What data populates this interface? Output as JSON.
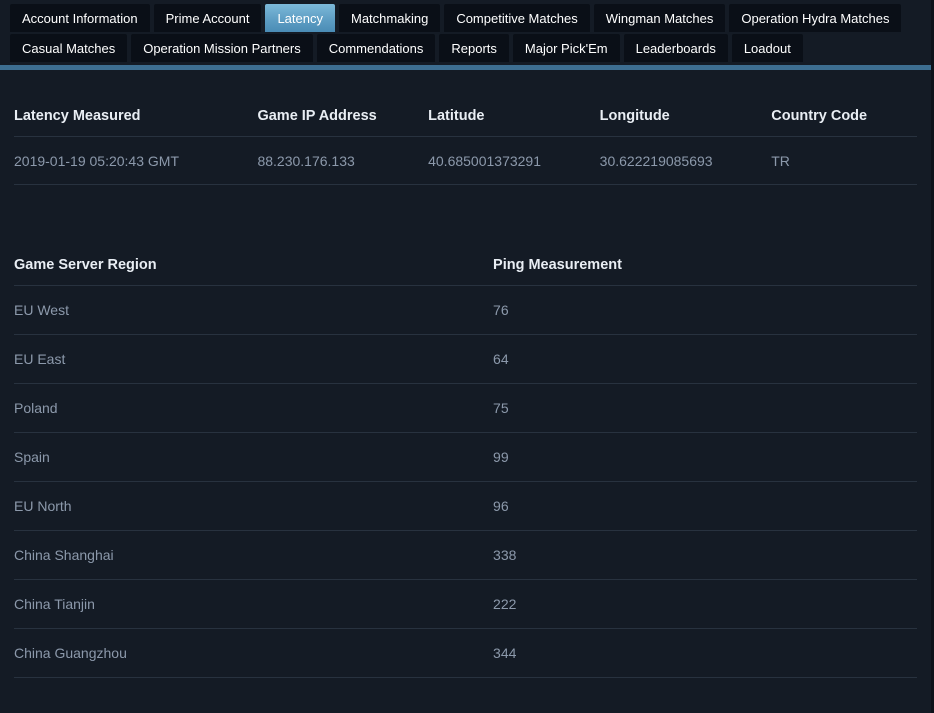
{
  "tabs": {
    "row1": [
      {
        "label": "Account Information",
        "active": false
      },
      {
        "label": "Prime Account",
        "active": false
      },
      {
        "label": "Latency",
        "active": true
      },
      {
        "label": "Matchmaking",
        "active": false
      },
      {
        "label": "Competitive Matches",
        "active": false
      },
      {
        "label": "Wingman Matches",
        "active": false
      },
      {
        "label": "Operation Hydra Matches",
        "active": false
      }
    ],
    "row2": [
      {
        "label": "Casual Matches",
        "active": false
      },
      {
        "label": "Operation Mission Partners",
        "active": false
      },
      {
        "label": "Commendations",
        "active": false
      },
      {
        "label": "Reports",
        "active": false
      },
      {
        "label": "Major Pick'Em",
        "active": false
      },
      {
        "label": "Leaderboards",
        "active": false
      },
      {
        "label": "Loadout",
        "active": false
      }
    ],
    "accent_color": "#5e9ec4",
    "underline_color": "#3d6e91"
  },
  "info_table": {
    "headers": [
      "Latency Measured",
      "Game IP Address",
      "Latitude",
      "Longitude",
      "Country Code"
    ],
    "rows": [
      [
        "2019-01-19 05:20:43 GMT",
        "88.230.176.133",
        "40.685001373291",
        "30.622219085693",
        "TR"
      ]
    ]
  },
  "ping_table": {
    "headers": [
      "Game Server Region",
      "Ping Measurement"
    ],
    "rows": [
      [
        "EU West",
        "76"
      ],
      [
        "EU East",
        "64"
      ],
      [
        "Poland",
        "75"
      ],
      [
        "Spain",
        "99"
      ],
      [
        "EU North",
        "96"
      ],
      [
        "China Shanghai",
        "338"
      ],
      [
        "China Tianjin",
        "222"
      ],
      [
        "China Guangzhou",
        "344"
      ]
    ]
  },
  "theme": {
    "background": "#141b25",
    "tab_background": "#0a0f17",
    "text_muted": "#8c99ab",
    "text_bright": "#e9eef4",
    "border": "#28323f"
  }
}
